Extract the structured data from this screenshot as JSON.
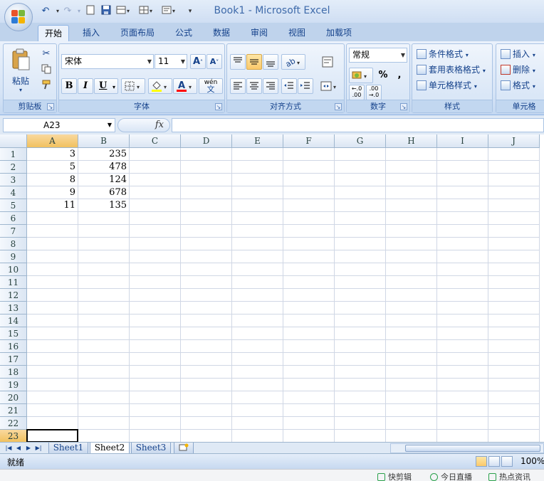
{
  "window": {
    "title": "Book1 - Microsoft Excel"
  },
  "tabs": [
    "开始",
    "插入",
    "页面布局",
    "公式",
    "数据",
    "审阅",
    "视图",
    "加载项"
  ],
  "ribbon": {
    "clipboard": {
      "label": "剪贴板",
      "paste": "粘贴"
    },
    "font": {
      "label": "字体",
      "name": "宋体",
      "size": "11",
      "bold": "B",
      "italic": "I",
      "underline": "U",
      "wen": "wén",
      "wen_char": "文"
    },
    "alignment": {
      "label": "对齐方式"
    },
    "number": {
      "label": "数字",
      "format": "常规",
      "percent": "%",
      "comma": ","
    },
    "styles": {
      "label": "样式",
      "conditional": "条件格式",
      "table_format": "套用表格格式",
      "cell_styles": "单元格样式"
    },
    "cells": {
      "label": "单元格",
      "insert": "插入",
      "delete": "删除",
      "format": "格式"
    }
  },
  "formula_bar": {
    "name_box": "A23",
    "fx": "fx",
    "content": ""
  },
  "grid": {
    "columns": [
      "A",
      "B",
      "C",
      "D",
      "E",
      "F",
      "G",
      "H",
      "I",
      "J"
    ],
    "rows": [
      "1",
      "2",
      "3",
      "4",
      "5",
      "6",
      "7",
      "8",
      "9",
      "10",
      "11",
      "12",
      "13",
      "14",
      "15",
      "16",
      "17",
      "18",
      "19",
      "20",
      "21",
      "22",
      "23"
    ],
    "data": [
      [
        "3",
        "235"
      ],
      [
        "5",
        "478"
      ],
      [
        "8",
        "124"
      ],
      [
        "9",
        "678"
      ],
      [
        "11",
        "135"
      ]
    ],
    "active_cell": "A23"
  },
  "sheets": [
    "Sheet1",
    "Sheet2",
    "Sheet3"
  ],
  "active_sheet": "Sheet2",
  "status": {
    "text": "就绪",
    "zoom": "100%"
  },
  "taskbar": [
    "快剪辑",
    "今日直播",
    "热点资讯"
  ]
}
